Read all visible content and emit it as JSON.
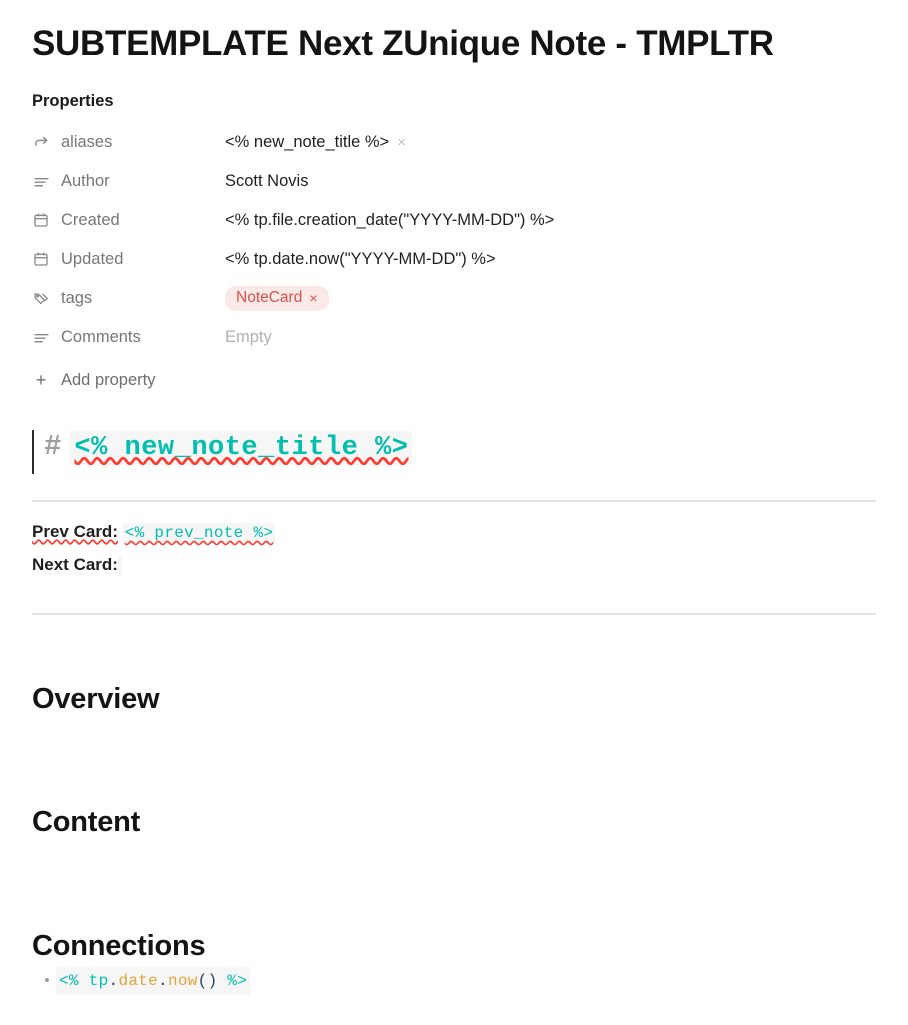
{
  "note": {
    "title": "SUBTEMPLATE Next ZUnique Note - TMPLTR"
  },
  "properties": {
    "heading": "Properties",
    "add_property_label": "Add property",
    "add_property_icon": "plus-icon",
    "rows": [
      {
        "icon": "arrow-turn-right-icon",
        "key": "aliases",
        "value": "<% new_note_title %>",
        "remove_label": "×",
        "type": "alias"
      },
      {
        "icon": "text-lines-icon",
        "key": "Author",
        "value": "Scott Novis",
        "type": "text"
      },
      {
        "icon": "calendar-icon",
        "key": "Created",
        "value": "<% tp.file.creation_date(\"YYYY-MM-DD\") %>",
        "type": "text"
      },
      {
        "icon": "calendar-icon",
        "key": "Updated",
        "value": "<% tp.date.now(\"YYYY-MM-DD\") %>",
        "type": "text"
      },
      {
        "icon": "tags-icon",
        "key": "tags",
        "value": "NoteCard",
        "remove_label": "×",
        "type": "tag"
      },
      {
        "icon": "text-lines-icon",
        "key": "Comments",
        "value": "Empty",
        "type": "empty"
      }
    ]
  },
  "editor": {
    "h1_line": {
      "hash": "#",
      "code": "<% new_note_title %>"
    },
    "prev_card": {
      "label": "Prev Card:",
      "code": "<% prev_note %>"
    },
    "next_card": {
      "label": "Next Card:",
      "code": ""
    },
    "sections": [
      {
        "heading": "Overview"
      },
      {
        "heading": "Content"
      },
      {
        "heading": "Connections"
      }
    ],
    "connections_bullet": {
      "bullet": "•",
      "tokens": [
        {
          "text": "<% ",
          "color": "#00bfaf"
        },
        {
          "text": "tp",
          "color": "#00bfaf"
        },
        {
          "text": ".",
          "color": "#2a3f5f"
        },
        {
          "text": "date",
          "color": "#e0a33a"
        },
        {
          "text": ".",
          "color": "#2a3f5f"
        },
        {
          "text": "now",
          "color": "#e0a33a"
        },
        {
          "text": "()",
          "color": "#2a3f5f"
        },
        {
          "text": " %>",
          "color": "#00bfaf"
        }
      ]
    }
  },
  "colors": {
    "template_teal": "#00bfaf",
    "tag_text": "#d9534f",
    "tag_bg": "#fbe9e7",
    "spellcheck": "#ff3b30",
    "rule": "#e3e3e3",
    "code_bg": "#f6f6f6"
  }
}
